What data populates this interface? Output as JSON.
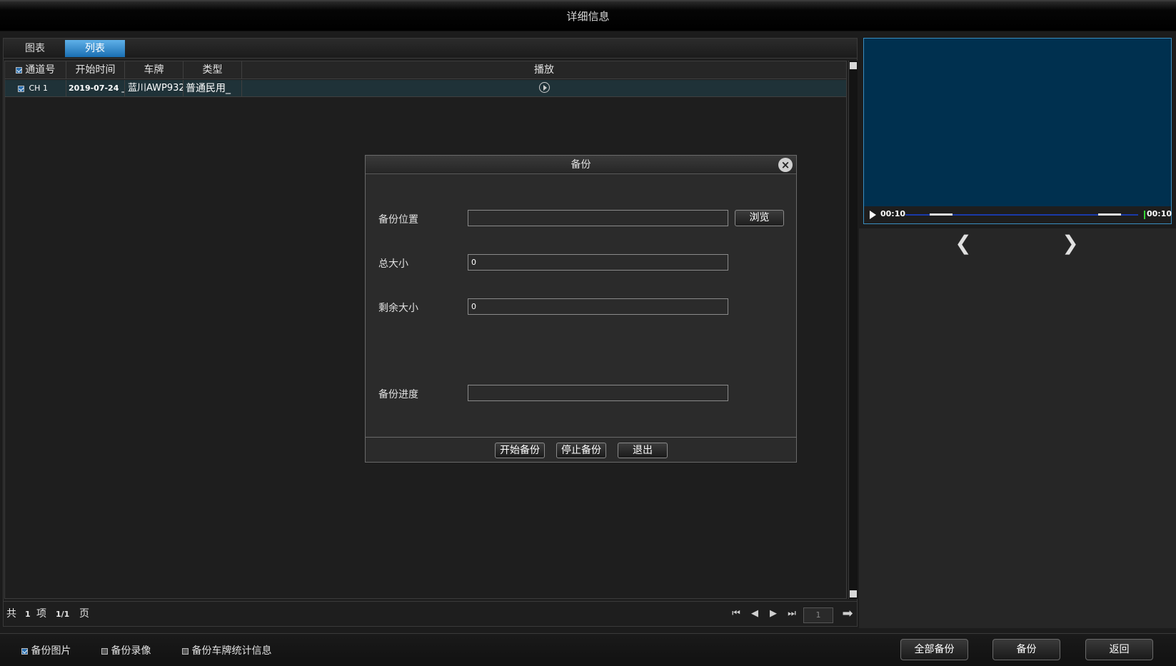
{
  "window": {
    "title": "详细信息"
  },
  "tabs": [
    {
      "label": "图表"
    },
    {
      "label": "列表"
    }
  ],
  "table": {
    "columns": [
      "通道号",
      "开始时间",
      "车牌",
      "类型",
      "播放"
    ],
    "rows": [
      {
        "channel": "CH 1",
        "start_time": "2019-07-24 _",
        "plate": "蓝川AWP932",
        "type": "普通民用_"
      }
    ]
  },
  "pager": {
    "total_prefix": "共",
    "total_count": "1",
    "total_unit": "项",
    "page_fraction": "1/1",
    "page_unit": "页",
    "page_input_value": "1"
  },
  "video": {
    "time_start": "00:10",
    "time_end": "00:10"
  },
  "dialog": {
    "title": "备份",
    "location_label": "备份位置",
    "location_value": "",
    "browse_label": "浏览",
    "total_size_label": "总大小",
    "total_size_value": "0",
    "remaining_label": "剩余大小",
    "remaining_value": "0",
    "progress_label": "备份进度",
    "progress_fraction": 0,
    "start_label": "开始备份",
    "stop_label": "停止备份",
    "exit_label": "退出"
  },
  "bottom": {
    "check_images": "备份图片",
    "check_video": "备份录像",
    "check_stats": "备份车牌统计信息",
    "backup_all": "全部备份",
    "backup": "备份",
    "back": "返回"
  },
  "colors": {
    "accent": "#1a6fb3",
    "video_bg": "#00304f",
    "row_selected": "#1f3238"
  }
}
